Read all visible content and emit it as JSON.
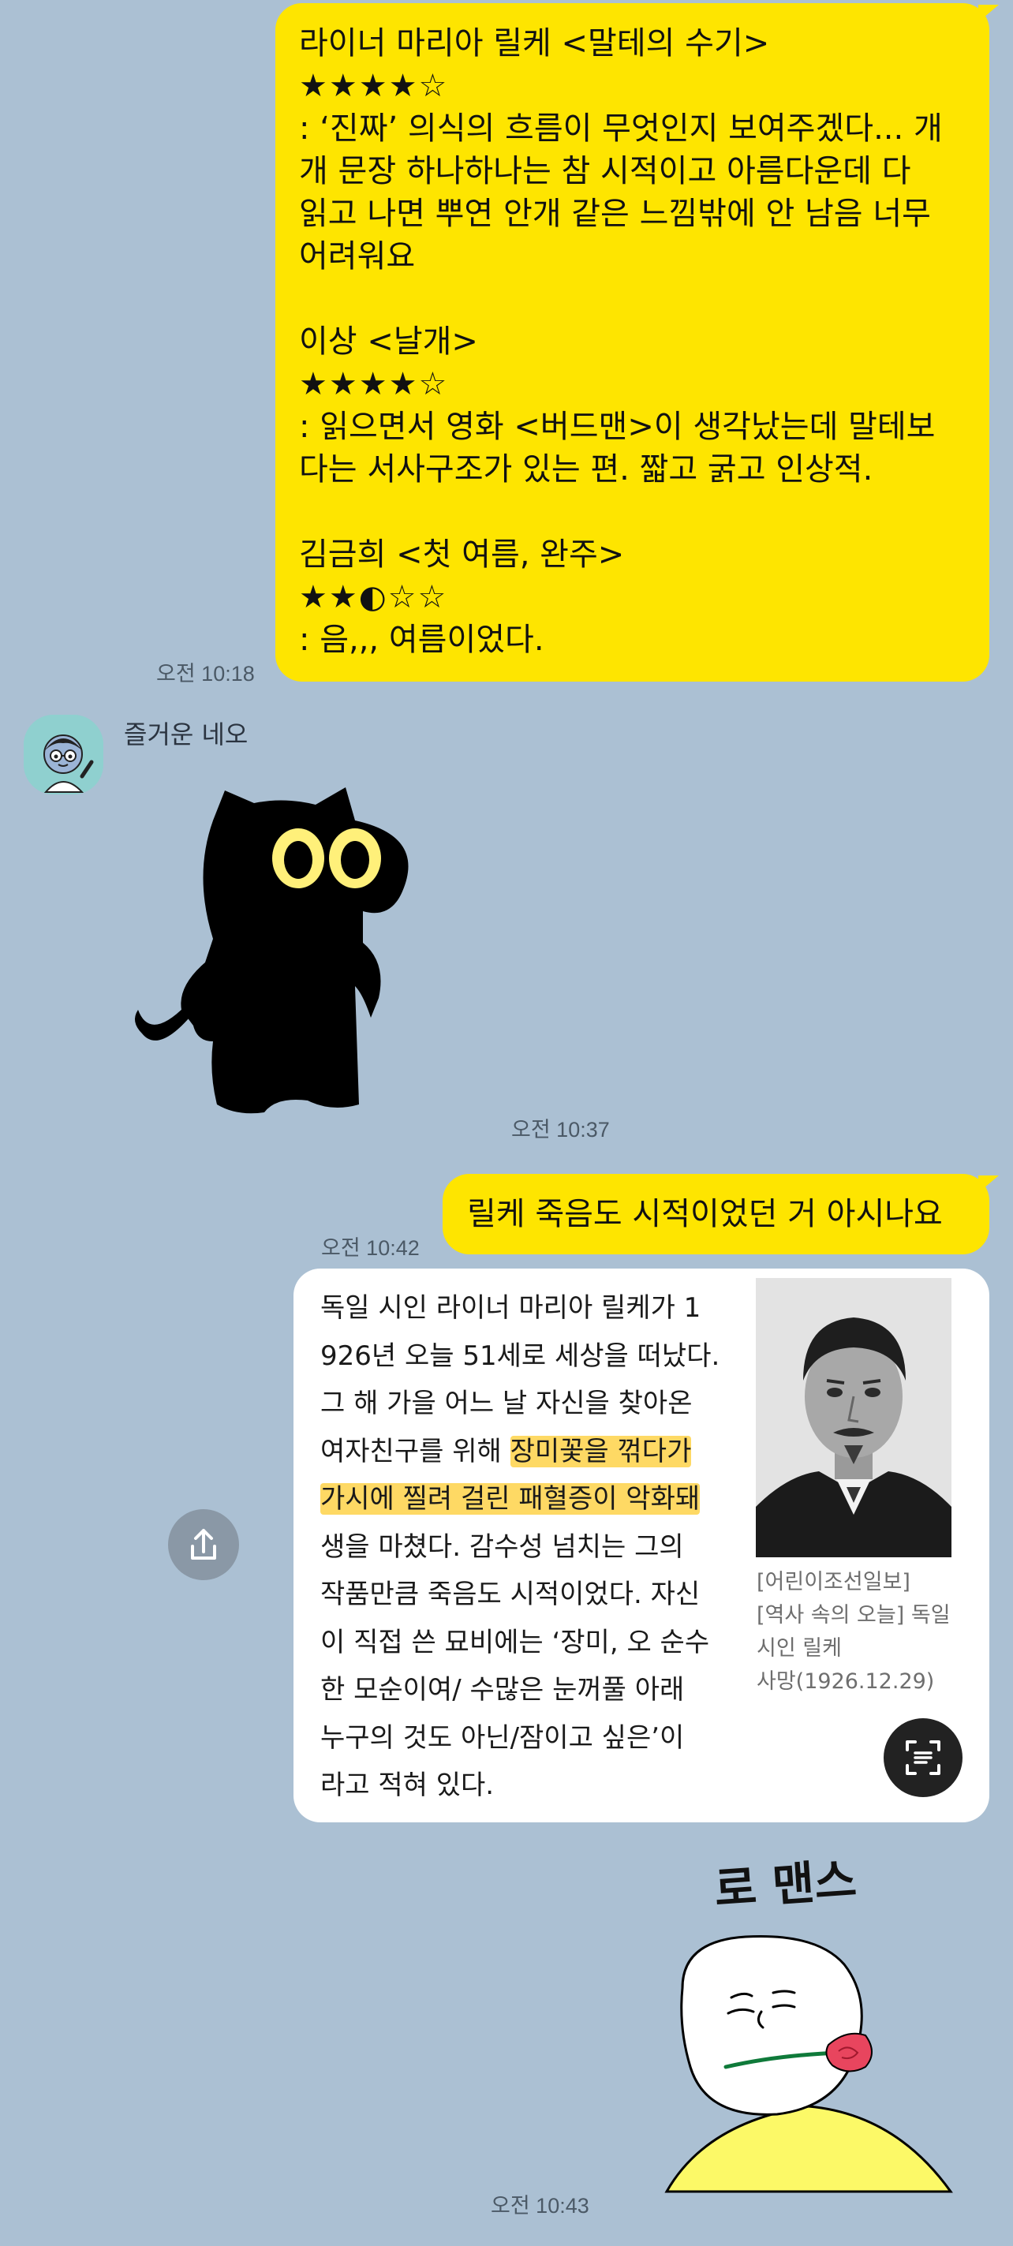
{
  "messages": {
    "review": {
      "lines": [
        "라이너 마리아 릴케 <말테의 수기>",
        "★★★★☆",
        ": ‘진짜’ 의식의 흐름이 무엇인지 보여주겠다... 개",
        "개 문장 하나하나는 참 시적이고 아름다운데 다",
        "읽고 나면 뿌연 안개 같은 느낌밖에 안 남음 너무",
        "어려워요",
        "",
        "이상 <날개>",
        "★★★★☆",
        ": 읽으면서 영화 <버드맨>이 생각났는데 말테보",
        "다는 서사구조가 있는 편. 짧고 굵고 인상적.",
        "",
        "김금희 <첫 여름, 완주>",
        "★★◐☆☆",
        ": 음,,, 여름이었다."
      ],
      "time": "오전 10:18"
    },
    "friend": {
      "name": "즐거운 네오",
      "time": "오전 10:37"
    },
    "question": {
      "text": "릴케 죽음도 시적이었던 거 아시나요",
      "time": "오전 10:42"
    },
    "article": {
      "body_lines": [
        "독일 시인 라이너 마리아 릴케가 1",
        "926년 오늘 51세로 세상을 떠났다.",
        "그 해 가을 어느 날 자신을 찾아온",
        "여자친구를 위해 ",
        "장미꽃을 꺾다가",
        "가시에 찔려 걸린 패혈증이 악화돼",
        "생을 마쳤다. 감수성 넘치는 그의",
        "작품만큼 죽음도 시적이었다. 자신",
        "이 직접 쓴 묘비에는 ‘장미, 오 순수",
        "한 모순이여/ 수많은 눈꺼풀 아래",
        "누구의 것도 아닌/잠이고 싶은’이",
        "라고 적혀 있다."
      ],
      "caption_lines": [
        "[어린이조선일보]",
        "[역사 속의 오늘] 독일",
        "시인 릴케",
        "사망(1926.12.29)"
      ]
    },
    "sticker": {
      "text": "로 맨스",
      "time": "오전 10:43"
    }
  },
  "colors": {
    "background": "#abc0d3",
    "my_bubble": "#fee500",
    "highlight": "#fdcc30"
  }
}
